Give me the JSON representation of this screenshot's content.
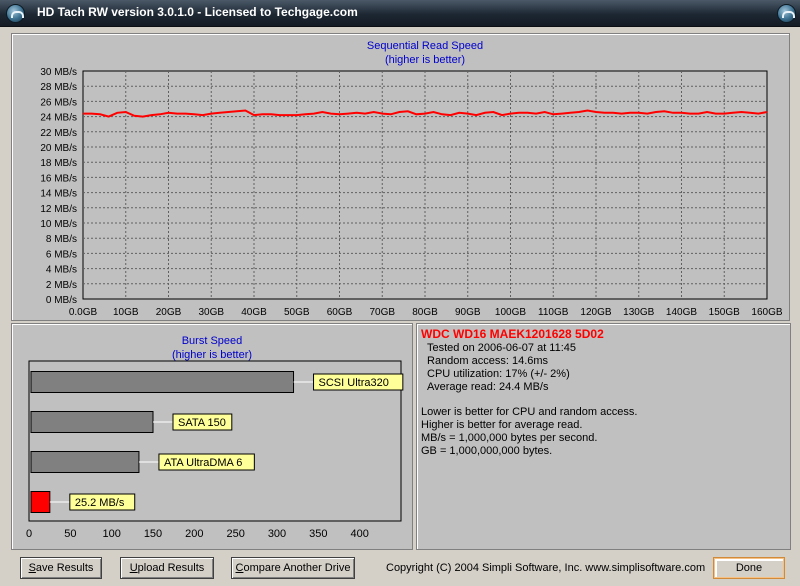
{
  "window": {
    "title": "HD Tach RW version 3.0.1.0 - Licensed to Techgage.com",
    "left_icon": "hdtach-app-icon",
    "right_icon": "close-circle-icon"
  },
  "info": {
    "drive_name": "WDC WD16 MAEK1201628 5D02",
    "lines": [
      "Tested on 2006-06-07 at 11:45",
      "Random access: 14.6ms",
      "CPU utilization: 17% (+/- 2%)",
      "Average read: 24.4 MB/s"
    ],
    "notes": [
      "Lower is better for CPU and random access.",
      "Higher is better for average read.",
      "MB/s = 1,000,000 bytes per second.",
      "GB = 1,000,000,000 bytes."
    ]
  },
  "buttons": {
    "save_rest": "ave Results",
    "save_key": "S",
    "upload_rest": "pload Results",
    "upload_key": "U",
    "compare_rest": "ompare Another Drive",
    "compare_key": "C",
    "done": "Done"
  },
  "copyright": "Copyright (C) 2004 Simpli Software, Inc. www.simplisoftware.com",
  "chart_data": [
    {
      "type": "line",
      "title": "Sequential Read Speed",
      "subtitle": "(higher is better)",
      "xlim": [
        0,
        160
      ],
      "ylim": [
        0,
        30
      ],
      "x_ticks": [
        "0.0GB",
        "10GB",
        "20GB",
        "30GB",
        "40GB",
        "50GB",
        "60GB",
        "70GB",
        "80GB",
        "90GB",
        "100GB",
        "110GB",
        "120GB",
        "130GB",
        "140GB",
        "150GB",
        "160GB"
      ],
      "y_ticks": [
        "0 MB/s",
        "2 MB/s",
        "4 MB/s",
        "6 MB/s",
        "8 MB/s",
        "10 MB/s",
        "12 MB/s",
        "14 MB/s",
        "16 MB/s",
        "18 MB/s",
        "20 MB/s",
        "22 MB/s",
        "24 MB/s",
        "26 MB/s",
        "28 MB/s",
        "30 MB/s"
      ],
      "grid": true,
      "series": [
        {
          "color": "#ff0000",
          "x": [
            0,
            2,
            4,
            6,
            8,
            10,
            12,
            14,
            16,
            18,
            20,
            22,
            24,
            26,
            28,
            30,
            32,
            34,
            36,
            38,
            40,
            42,
            44,
            46,
            48,
            50,
            52,
            54,
            56,
            58,
            60,
            62,
            64,
            66,
            68,
            70,
            72,
            74,
            76,
            78,
            80,
            82,
            84,
            86,
            88,
            90,
            92,
            94,
            96,
            98,
            100,
            102,
            104,
            106,
            108,
            110,
            112,
            114,
            116,
            118,
            120,
            122,
            124,
            126,
            128,
            130,
            132,
            134,
            136,
            138,
            140,
            142,
            144,
            146,
            148,
            150,
            152,
            154,
            156,
            158,
            160
          ],
          "y": [
            24.4,
            24.4,
            24.3,
            24.0,
            24.5,
            24.6,
            24.1,
            24.0,
            24.2,
            24.3,
            24.5,
            24.4,
            24.4,
            24.3,
            24.2,
            24.4,
            24.5,
            24.6,
            24.7,
            24.8,
            24.2,
            24.3,
            24.3,
            24.2,
            24.2,
            24.2,
            24.3,
            24.4,
            24.6,
            24.4,
            24.3,
            24.4,
            24.5,
            24.4,
            24.6,
            24.4,
            24.3,
            24.6,
            24.7,
            24.3,
            24.4,
            24.6,
            24.3,
            24.2,
            24.5,
            24.4,
            24.2,
            24.5,
            24.6,
            24.2,
            24.4,
            24.5,
            24.5,
            24.4,
            24.6,
            24.3,
            24.4,
            24.5,
            24.6,
            24.8,
            24.6,
            24.5,
            24.5,
            24.4,
            24.5,
            24.5,
            24.4,
            24.6,
            24.7,
            24.5,
            24.5,
            24.4,
            24.4,
            24.6,
            24.4,
            24.4,
            24.5,
            24.6,
            24.5,
            24.4,
            24.6
          ]
        }
      ]
    },
    {
      "type": "bar",
      "orientation": "horizontal",
      "title": "Burst Speed",
      "subtitle": "(higher is better)",
      "xlim": [
        0,
        450
      ],
      "x_ticks": [
        0,
        50,
        100,
        150,
        200,
        250,
        300,
        350,
        400
      ],
      "categories": [
        "SCSI Ultra320",
        "SATA 150",
        "ATA UltraDMA 6",
        "25.2 MB/s"
      ],
      "values": [
        320,
        150,
        133,
        25.2
      ],
      "colors": [
        "#808080",
        "#808080",
        "#808080",
        "#ff0000"
      ]
    }
  ]
}
